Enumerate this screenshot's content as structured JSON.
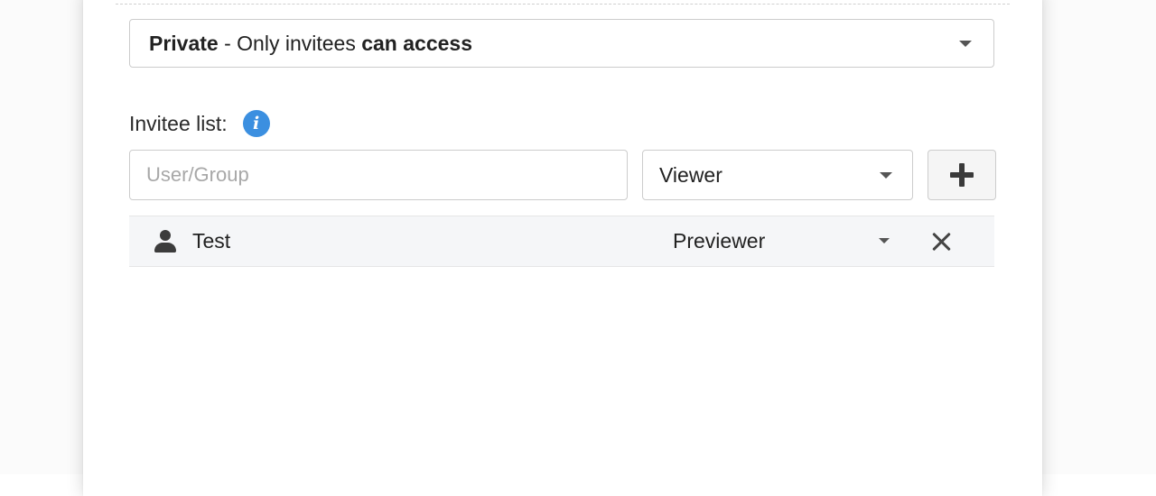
{
  "access": {
    "level_bold": "Private",
    "separator": " - Only invitees ",
    "suffix_bold": "can access"
  },
  "invitees": {
    "label": "Invitee list:",
    "info_icon": "info-icon",
    "search_placeholder": "User/Group",
    "role_selected": "Viewer",
    "add_icon": "plus-icon",
    "rows": [
      {
        "icon": "person-icon",
        "name": "Test",
        "role": "Previewer",
        "remove_icon": "close-icon"
      }
    ]
  },
  "colors": {
    "info_accent": "#3b8fe0",
    "row_background": "#f5f6f8",
    "border": "#cccccc"
  }
}
